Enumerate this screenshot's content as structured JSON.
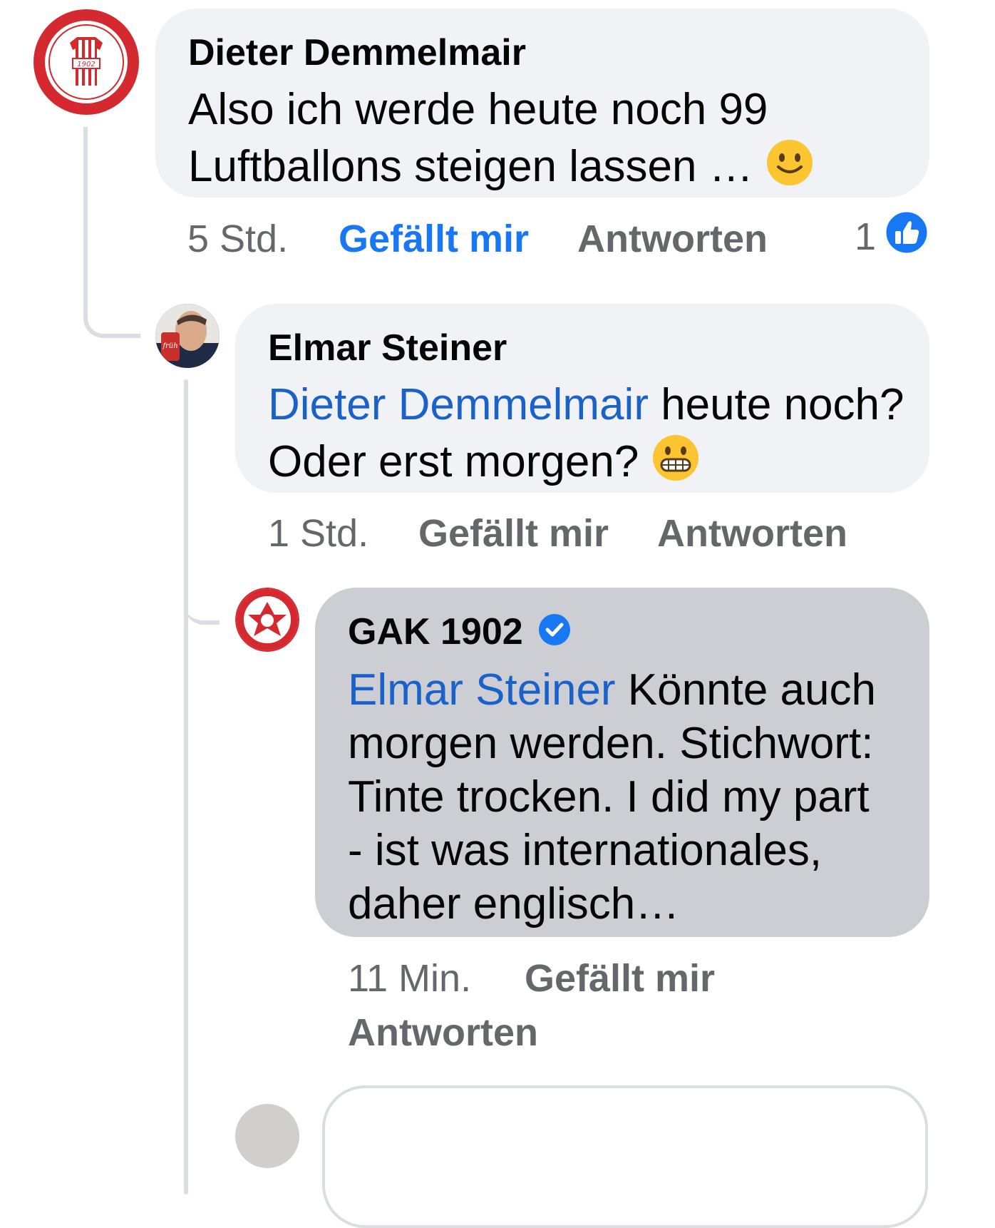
{
  "comments": [
    {
      "author": "Dieter Demmelmair",
      "text": "Also ich werde heute noch 99 Luftballons steigen lassen …",
      "text_line1": "Also ich werde heute noch 99",
      "text_line2": "Luftballons steigen lassen …",
      "emoji": "slightly-smiling-face",
      "time": "5 Std.",
      "like_label": "Gefällt mir",
      "like_active": true,
      "reply_label": "Antworten",
      "reaction_count": "1",
      "avatar": "gak-hauptsponsor-badge"
    },
    {
      "author": "Elmar Steiner",
      "mention": "Dieter Demmelmair",
      "text_after_mention": " heute noch?",
      "text_line2": "Oder erst morgen?",
      "emoji": "grimacing-face",
      "time": "1 Std.",
      "like_label": "Gefällt mir",
      "reply_label": "Antworten",
      "avatar": "user-photo"
    },
    {
      "author": "GAK 1902",
      "verified": true,
      "mention": "Elmar Steiner",
      "text_after_mention": " Könnte auch",
      "text_line2": "morgen werden. Stichwort:",
      "text_line3": "Tinte trocken. I did my part",
      "text_line4": "- ist was internationales,",
      "text_line5": "daher englisch…",
      "time": "11 Min.",
      "like_label": "Gefällt mir",
      "reply_label": "Antworten",
      "avatar": "gak-club-logo"
    }
  ],
  "colors": {
    "bubble_light": "#f0f2f5",
    "bubble_highlight": "#ccced3",
    "mention": "#1a62c9",
    "like_active": "#1877f2",
    "meta": "#65676b"
  }
}
